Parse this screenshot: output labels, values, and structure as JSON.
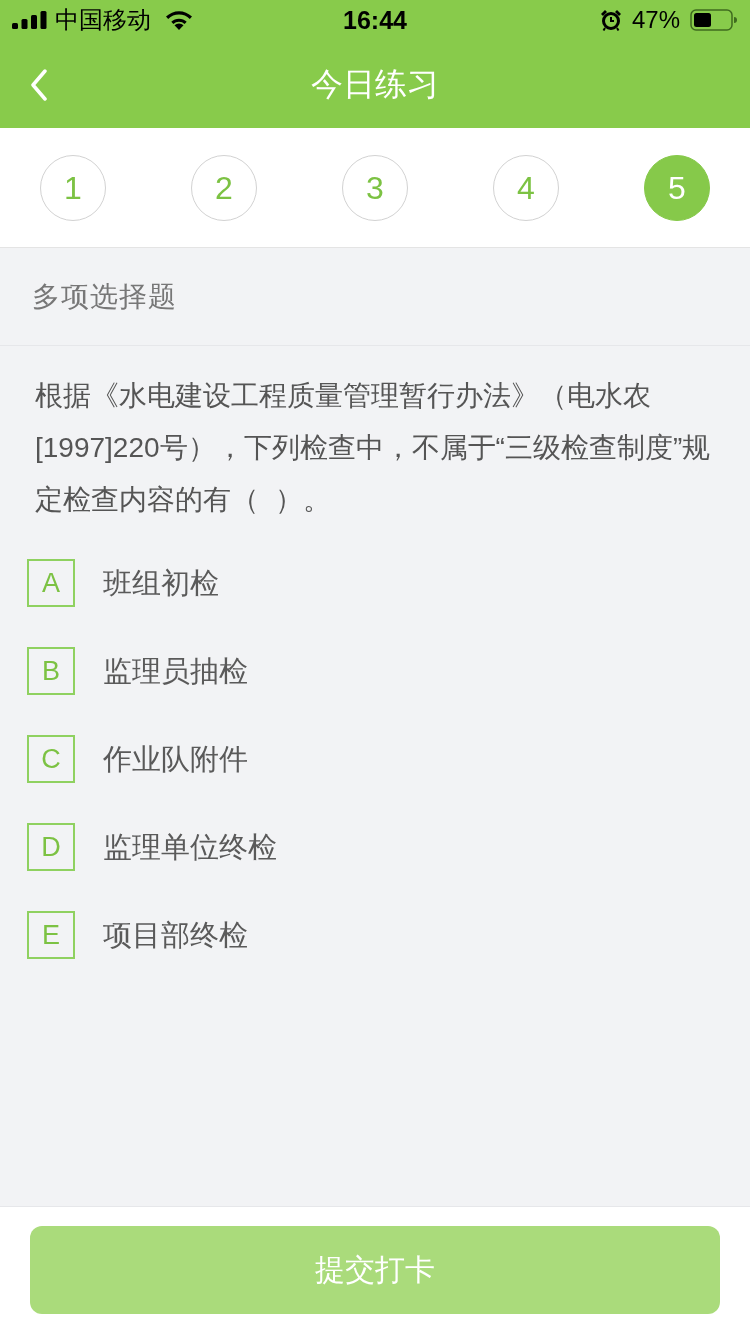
{
  "status_bar": {
    "carrier": "中国移动",
    "time": "16:44",
    "battery": "47%"
  },
  "nav": {
    "title": "今日练习"
  },
  "question_tabs": [
    {
      "label": "1",
      "selected": false
    },
    {
      "label": "2",
      "selected": false
    },
    {
      "label": "3",
      "selected": false
    },
    {
      "label": "4",
      "selected": false
    },
    {
      "label": "5",
      "selected": true
    }
  ],
  "question": {
    "type_label": "多项选择题",
    "text": "根据《水电建设工程质量管理暂行办法》（电水农[1997]220号），下列检查中，不属于“三级检查制度”规定检查内容的有（  ）。",
    "options": [
      {
        "letter": "A",
        "text": "班组初检",
        "selected": false
      },
      {
        "letter": "B",
        "text": "监理员抽检",
        "selected": false
      },
      {
        "letter": "C",
        "text": "作业队附件",
        "selected": false
      },
      {
        "letter": "D",
        "text": "监理单位终检",
        "selected": false
      },
      {
        "letter": "E",
        "text": "项目部终检",
        "selected": false
      }
    ]
  },
  "submit_button": {
    "label": "提交打卡",
    "disabled": true
  }
}
